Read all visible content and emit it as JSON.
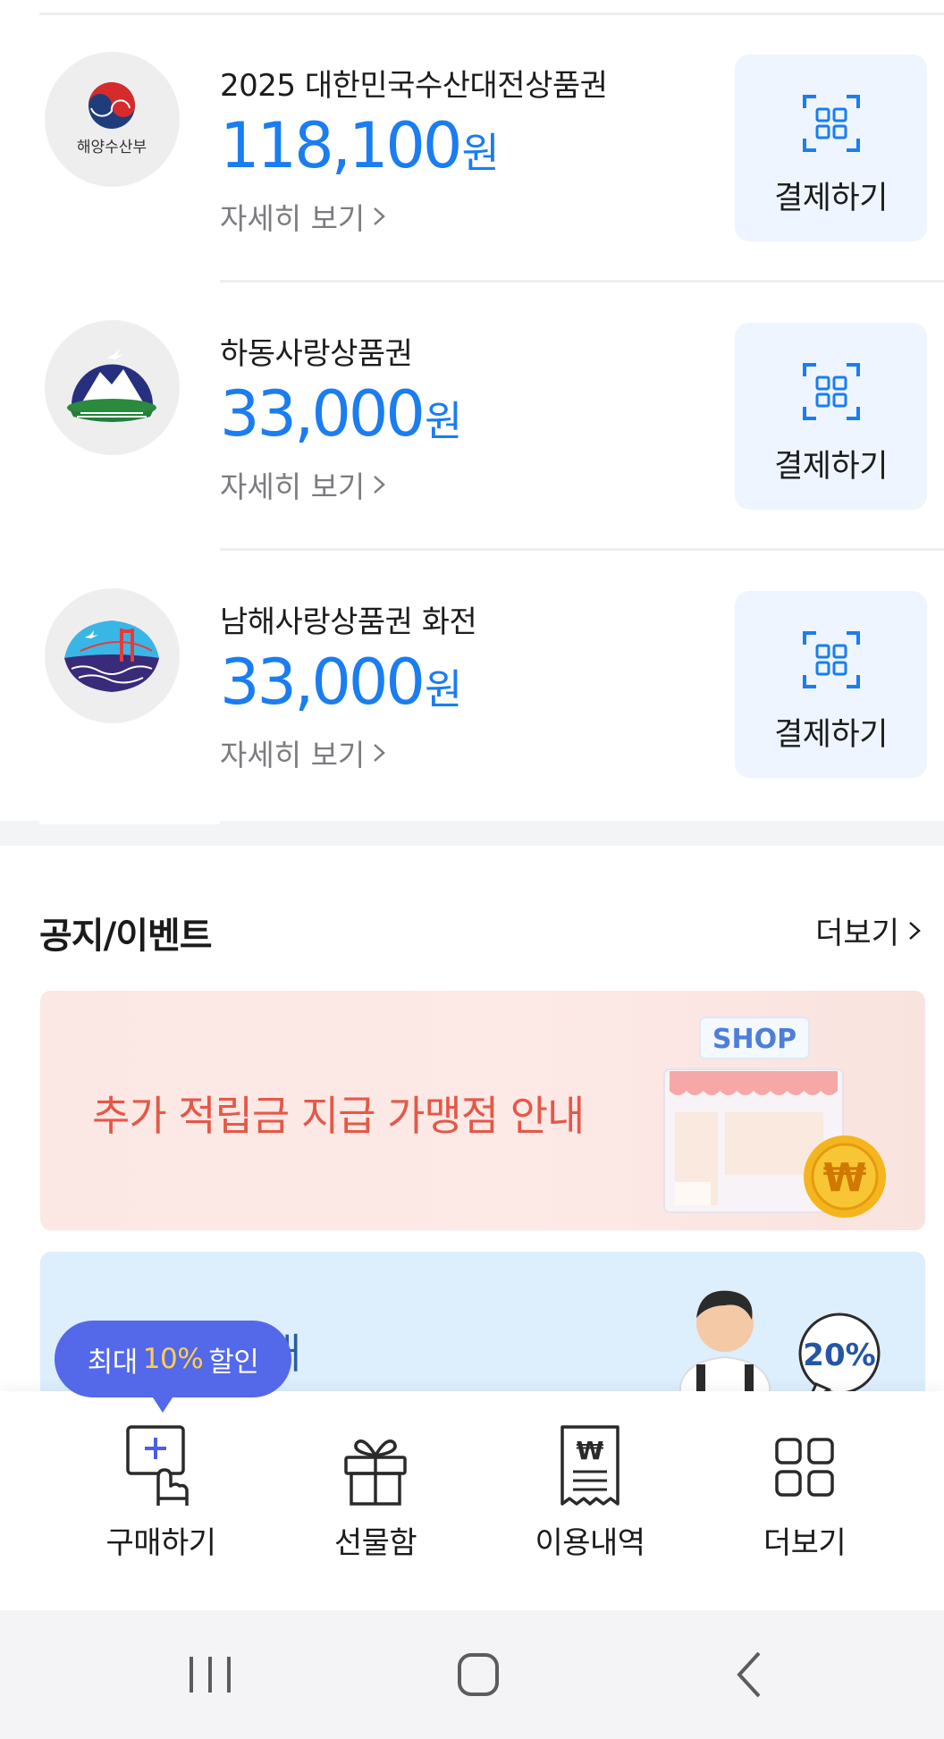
{
  "vouchers": [
    {
      "logo_icon": "ministry-of-oceans-logo-icon",
      "logo_text": "해양수산부",
      "name": "2025 대한민국수산대전상품권",
      "amount": "118,100",
      "unit": "원",
      "detail": "자세히 보기",
      "pay_label": "결제하기"
    },
    {
      "logo_icon": "hadong-mountain-logo-icon",
      "name": "하동사랑상품권",
      "amount": "33,000",
      "unit": "원",
      "detail": "자세히 보기",
      "pay_label": "결제하기"
    },
    {
      "logo_icon": "namhae-bridge-logo-icon",
      "name": "남해사랑상품권 화전",
      "amount": "33,000",
      "unit": "원",
      "detail": "자세히 보기",
      "pay_label": "결제하기"
    }
  ],
  "notices": {
    "title": "공지/이벤트",
    "more": "더보기",
    "banners": [
      {
        "text": "추가 적립금 지급 가맹점 안내",
        "sign": "SHOP",
        "icon": "shop-coin-icon",
        "coin_symbol": "₩"
      },
      {
        "text": "내",
        "badge": "20%",
        "icon": "person-discount-icon"
      }
    ]
  },
  "promo": {
    "prefix": "최대",
    "highlight": "10%",
    "suffix": "할인"
  },
  "bottom_nav": [
    {
      "label": "구매하기",
      "icon": "purchase-touch-icon"
    },
    {
      "label": "선물함",
      "icon": "gift-icon"
    },
    {
      "label": "이용내역",
      "icon": "receipt-won-icon"
    },
    {
      "label": "더보기",
      "icon": "grid-more-icon"
    }
  ],
  "system_nav": [
    {
      "icon": "recent-apps-icon"
    },
    {
      "icon": "home-icon"
    },
    {
      "icon": "back-icon"
    }
  ],
  "colors": {
    "accent_blue": "#1a7df0",
    "pay_button_bg": "#eef5fe",
    "promo_bg": "#5468ea",
    "promo_highlight": "#ffcf4a",
    "banner1_text": "#e45848"
  }
}
